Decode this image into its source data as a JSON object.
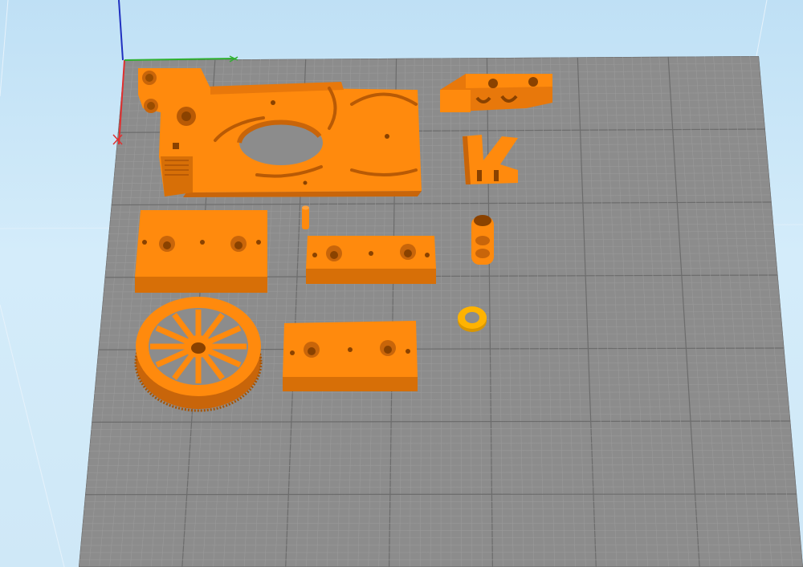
{
  "viewport": {
    "background_top": "#bfe0f5",
    "background_bottom": "#cfe8f7",
    "bed_color": "#8c8c8c",
    "grid_minor_color": "#9a9a9a",
    "grid_major_color": "#6c6c6c"
  },
  "axes": {
    "x_color": "#e03030",
    "y_color": "#30b030",
    "z_color": "#2030c0"
  },
  "parts_color": "#ff8a0d",
  "parts_shade": "#d06a00",
  "selected_color": "#ffb300",
  "parts": [
    {
      "name": "carriage-plate",
      "icon": "plate-with-motor-cutout"
    },
    {
      "name": "idler-bracket",
      "icon": "bracket"
    },
    {
      "name": "fork-clamp",
      "icon": "fork"
    },
    {
      "name": "pin",
      "icon": "pin"
    },
    {
      "name": "spacer-tall",
      "icon": "spacer"
    },
    {
      "name": "block-left",
      "icon": "block"
    },
    {
      "name": "block-middle",
      "icon": "block"
    },
    {
      "name": "block-bottom",
      "icon": "block"
    },
    {
      "name": "pulley-gear",
      "icon": "pulley"
    },
    {
      "name": "washer",
      "icon": "washer",
      "selected": true
    }
  ]
}
